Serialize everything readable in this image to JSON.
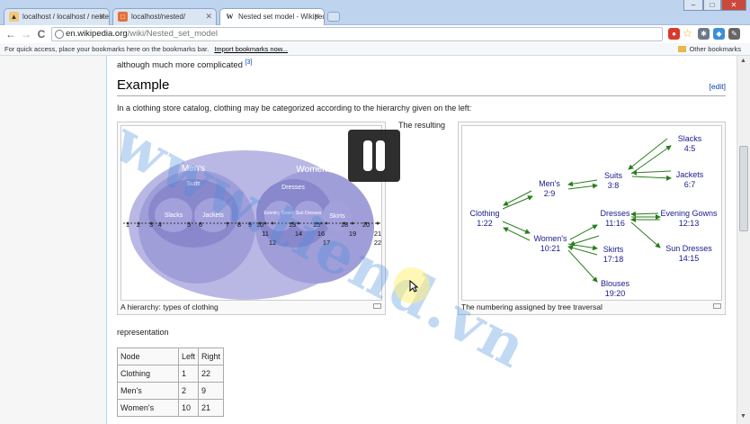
{
  "browser": {
    "tabs": [
      {
        "label": "localhost / localhost / neste",
        "favicon": "pma-icon"
      },
      {
        "label": "localhost/nested/",
        "favicon": "page-icon"
      },
      {
        "label": "Nested set model - Wikiped",
        "favicon": "wikipedia-icon"
      }
    ],
    "window_controls": [
      "–",
      "□",
      "✕"
    ],
    "nav": {
      "back": "←",
      "forward": "→",
      "reload": "C"
    },
    "url": {
      "host": "en.wikipedia.org",
      "path": "/wiki/Nested_set_model"
    },
    "bookmarks_hint": "For quick access, place your bookmarks here on the bookmarks bar.",
    "import_link": "Import bookmarks now...",
    "other_bookmarks": "Other bookmarks",
    "accent": "#bdd3ee"
  },
  "article": {
    "intro_tail": "although much more complicated",
    "cite": "[3]",
    "heading": "Example",
    "edit": "[edit]",
    "lead": "In a clothing store catalog, clothing may be categorized according to the hierarchy given on the left:",
    "between": "The resulting",
    "after": "representation",
    "figure_left": {
      "caption": "A hierarchy: types of clothing",
      "labels": {
        "clothing": "Clothing",
        "mens": "Men's",
        "womens": "Women's",
        "suits": "Suits",
        "slacks": "Slacks",
        "jackets": "Jackets",
        "dresses": "Dresses",
        "evening": "Evening Gowns",
        "sun": "Sun Dresses",
        "skirts": "Skirts"
      },
      "numbers": [
        "1",
        "2",
        "3",
        "4",
        "5",
        "6",
        "7",
        "8",
        "9",
        "10",
        "11",
        "12",
        "13",
        "14",
        "15",
        "16",
        "17",
        "18",
        "19",
        "20",
        "21",
        "22"
      ]
    },
    "figure_right": {
      "caption": "The numbering assigned by tree traversal",
      "nodes": [
        {
          "name": "Clothing",
          "range": "1:22"
        },
        {
          "name": "Men's",
          "range": "2:9"
        },
        {
          "name": "Women's",
          "range": "10:21"
        },
        {
          "name": "Suits",
          "range": "3:8"
        },
        {
          "name": "Slacks",
          "range": "4:5"
        },
        {
          "name": "Jackets",
          "range": "6:7"
        },
        {
          "name": "Dresses",
          "range": "11:16"
        },
        {
          "name": "Evening Gowns",
          "range": "12:13"
        },
        {
          "name": "Sun Dresses",
          "range": "14:15"
        },
        {
          "name": "Skirts",
          "range": "17:18"
        },
        {
          "name": "Blouses",
          "range": "19:20"
        }
      ]
    },
    "table": {
      "headers": [
        "Node",
        "Left",
        "Right"
      ],
      "rows": [
        [
          "Clothing",
          "1",
          "22"
        ],
        [
          "Men's",
          "2",
          "9"
        ],
        [
          "Women's",
          "10",
          "21"
        ]
      ]
    },
    "watermark": "www.tiend.vn"
  }
}
